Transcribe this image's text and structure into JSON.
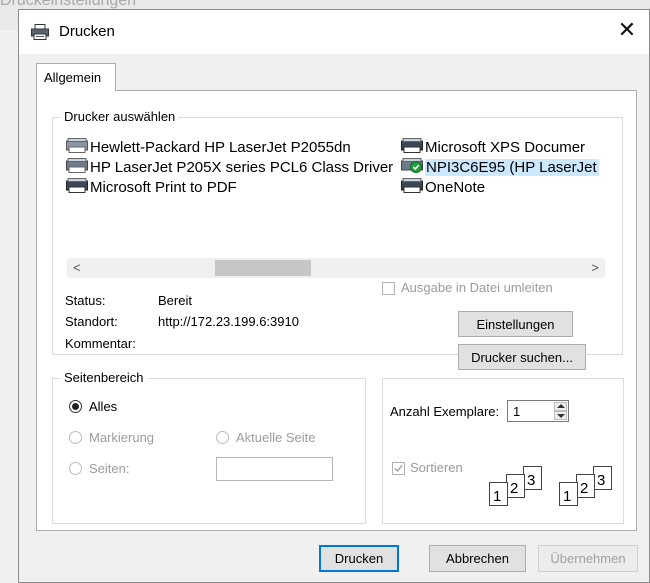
{
  "background_title": "Druckeinstellungen",
  "dialog": {
    "title": "Drucken",
    "close_symbol": "✕",
    "tab": "Allgemein"
  },
  "printer_group": {
    "title": "Drucker auswählen",
    "printers": [
      {
        "name": "Hewlett-Packard HP LaserJet P2055dn",
        "selected": false
      },
      {
        "name": "HP LaserJet P205X series PCL6 Class Driver",
        "selected": false
      },
      {
        "name": "Microsoft Print to PDF",
        "selected": false
      },
      {
        "name": "Microsoft XPS Documer",
        "selected": false
      },
      {
        "name": "NPI3C6E95 (HP LaserJet",
        "selected": true
      },
      {
        "name": "OneNote",
        "selected": false
      }
    ],
    "scroll_left": "<",
    "scroll_right": ">",
    "status_label": "Status:",
    "status_value": "Bereit",
    "location_label": "Standort:",
    "location_value": "http://172.23.199.6:3910",
    "comment_label": "Kommentar:",
    "redirect_label": "Ausgabe in Datei umleiten",
    "settings_button": "Einstellungen",
    "find_button": "Drucker suchen..."
  },
  "page_range": {
    "title": "Seitenbereich",
    "all": "Alles",
    "selection": "Markierung",
    "current_page": "Aktuelle Seite",
    "pages": "Seiten:",
    "pages_value": ""
  },
  "copies": {
    "label": "Anzahl Exemplare:",
    "value": "1",
    "collate_label": "Sortieren",
    "page_digits": [
      "1",
      "2",
      "3"
    ]
  },
  "buttons": {
    "print": "Drucken",
    "cancel": "Abbrechen",
    "apply": "Übernehmen"
  },
  "colors": {
    "selection": "#cce8ff",
    "primary_border": "#0078d7"
  },
  "icons": {
    "printer": "printer-icon",
    "default_check": "check-circle-icon"
  }
}
